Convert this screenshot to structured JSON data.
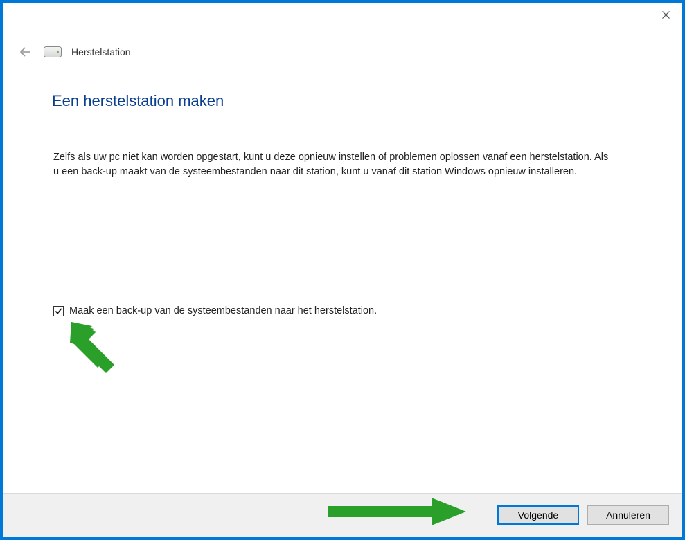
{
  "header": {
    "wizard_name": "Herstelstation"
  },
  "main": {
    "title": "Een herstelstation maken",
    "body": "Zelfs als uw pc niet kan worden opgestart, kunt u deze opnieuw instellen of problemen oplossen vanaf een herstelstation. Als u een back-up maakt van de systeembestanden naar dit station, kunt u vanaf dit station Windows opnieuw installeren.",
    "checkbox": {
      "checked": true,
      "label": "Maak een back-up van de systeembestanden naar het herstelstation."
    }
  },
  "footer": {
    "next": "Volgende",
    "cancel": "Annuleren"
  }
}
